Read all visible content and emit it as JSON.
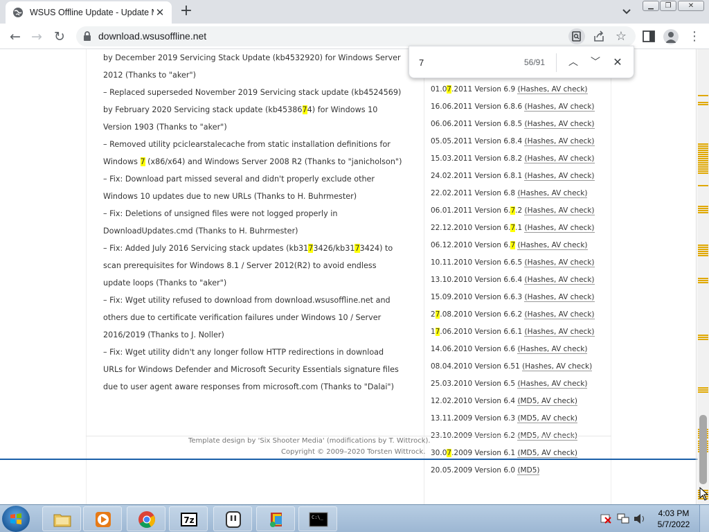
{
  "browser": {
    "tab_title": "WSUS Offline Update - Update M",
    "url": "download.wsusoffline.net",
    "new_tab_glyph": "+",
    "tab_close_glyph": "✕"
  },
  "findbar": {
    "query": "7",
    "count": "56/91"
  },
  "left_lines": [
    [
      "by December 2019 Servicing Stack Update (kb4532920) for Windows Server"
    ],
    [
      "2012 (Thanks to \"aker\")"
    ],
    [
      "– Replaced superseded November 2019 Servicing stack update (kb4524569)"
    ],
    [
      "by February 2020 Servicing stack update (kb45386",
      "7",
      "4) for Windows 10"
    ],
    [
      "Version 1903 (Thanks to \"aker\")"
    ],
    [
      "– Removed utility pciclearstalecache from static installation definitions for"
    ],
    [
      "Windows ",
      "7",
      " (x86/x64) and Windows Server 2008 R2 (Thanks to \"janicholson\")"
    ],
    [
      "– Fix: Download part missed several and didn't properly exclude other"
    ],
    [
      "Windows 10 updates due to new URLs (Thanks to H. Buhrmester)"
    ],
    [
      "– Fix: Deletions of unsigned files were not logged properly in"
    ],
    [
      "DownloadUpdates.cmd (Thanks to H. Buhrmester)"
    ],
    [
      "– Fix: Added July 2016 Servicing stack updates (kb31",
      "7",
      "3426/kb31",
      "7",
      "3424) to"
    ],
    [
      "scan prerequisites for Windows 8.1 / Server 2012(R2) to avoid endless"
    ],
    [
      "update loops (Thanks to \"aker\")"
    ],
    [
      "– Fix: Wget utility refused to download from download.wsusoffline.net and"
    ],
    [
      "others due to certificate verification failures under Windows 10 / Server"
    ],
    [
      "2016/2019 (Thanks to J. Noller)"
    ],
    [
      "– Fix: Wget utility didn't any longer follow HTTP redirections in download"
    ],
    [
      "URLs for Windows Defender and Microsoft Security Essentials signature files"
    ],
    [
      "due to user agent aware responses from microsoft.com (Thanks to \"Dalai\")"
    ]
  ],
  "versions": [
    {
      "date": [
        "01.0",
        "7",
        ".2011"
      ],
      "label": [
        " Version 6.9 ",
        "(Hashes, AV check)"
      ]
    },
    {
      "date": [
        "16.06.2011"
      ],
      "label": [
        " Version 6.8.6 ",
        "(Hashes, AV check)"
      ]
    },
    {
      "date": [
        "06.06.2011"
      ],
      "label": [
        " Version 6.8.5 ",
        "(Hashes, AV check)"
      ]
    },
    {
      "date": [
        "05.05.2011"
      ],
      "label": [
        " Version 6.8.4 ",
        "(Hashes, AV check)"
      ]
    },
    {
      "date": [
        "15.03.2011"
      ],
      "label": [
        " Version 6.8.2 ",
        "(Hashes, AV check)"
      ]
    },
    {
      "date": [
        "24.02.2011"
      ],
      "label": [
        " Version 6.8.1 ",
        "(Hashes, AV check)"
      ]
    },
    {
      "date": [
        "22.02.2011"
      ],
      "label": [
        " Version 6.8 ",
        "(Hashes, AV check)"
      ]
    },
    {
      "date": [
        "06.01.2011"
      ],
      "label": [
        " Version 6.",
        "7",
        ".2 ",
        "(Hashes, AV check)"
      ]
    },
    {
      "date": [
        "22.12.2010"
      ],
      "label": [
        " Version 6.",
        "7",
        ".1 ",
        "(Hashes, AV check)"
      ]
    },
    {
      "date": [
        "06.12.2010"
      ],
      "label": [
        " Version 6.",
        "7",
        " ",
        "(Hashes, AV check)"
      ]
    },
    {
      "date": [
        "10.11.2010"
      ],
      "label": [
        " Version 6.6.5 ",
        "(Hashes, AV check)"
      ]
    },
    {
      "date": [
        "13.10.2010"
      ],
      "label": [
        " Version 6.6.4 ",
        "(Hashes, AV check)"
      ]
    },
    {
      "date": [
        "15.09.2010"
      ],
      "label": [
        " Version 6.6.3 ",
        "(Hashes, AV check)"
      ]
    },
    {
      "date": [
        "2",
        "7",
        ".08.2010"
      ],
      "label": [
        " Version 6.6.2 ",
        "(Hashes, AV check)"
      ]
    },
    {
      "date": [
        "1",
        "7",
        ".06.2010"
      ],
      "label": [
        " Version 6.6.1 ",
        "(Hashes, AV check)"
      ]
    },
    {
      "date": [
        "14.06.2010"
      ],
      "label": [
        " Version 6.6 ",
        "(Hashes, AV check)"
      ]
    },
    {
      "date": [
        "08.04.2010"
      ],
      "label": [
        " Version 6.51 ",
        "(Hashes, AV check)"
      ]
    },
    {
      "date": [
        "25.03.2010"
      ],
      "label": [
        " Version 6.5 ",
        "(Hashes, AV check)"
      ]
    },
    {
      "date": [
        "12.02.2010"
      ],
      "label": [
        " Version 6.4 ",
        "(MD5, AV check)"
      ]
    },
    {
      "date": [
        "13.11.2009"
      ],
      "label": [
        " Version 6.3 ",
        "(MD5, AV check)"
      ]
    },
    {
      "date": [
        "23.10.2009"
      ],
      "label": [
        " Version 6.2 ",
        "(MD5, AV check)"
      ]
    },
    {
      "date": [
        "30.0",
        "7",
        ".2009"
      ],
      "label": [
        " Version 6.1 ",
        "(MD5, AV check)"
      ]
    },
    {
      "date": [
        "20.05.2009"
      ],
      "label": [
        " Version 6.0 ",
        "(MD5)"
      ]
    }
  ],
  "footer": {
    "credit": "Template design by 'Six Shooter Media' (modifications by T. Wittrock).",
    "copyright": "Copyright © 2009–2020 Torsten Wittrock."
  },
  "taskbar": {
    "apps": [
      "explorer",
      "media-player",
      "chrome",
      "7zip",
      "task-app",
      "installer",
      "cmd"
    ],
    "time": "4:03 PM",
    "date": "5/7/2022"
  },
  "colors": {
    "highlight": "#ffff00",
    "tick": "#e0a800",
    "link_line": "#1a5fa8"
  },
  "icons": {
    "tab_favicon": "globe-icon",
    "back": "arrow-left-icon",
    "forward": "arrow-right-icon",
    "reload": "reload-icon",
    "lock": "lock-icon",
    "find": "find-icon",
    "share": "share-icon",
    "star": "star-icon",
    "side_panel": "side-panel-icon",
    "profile": "profile-icon",
    "menu": "kebab-menu-icon"
  }
}
